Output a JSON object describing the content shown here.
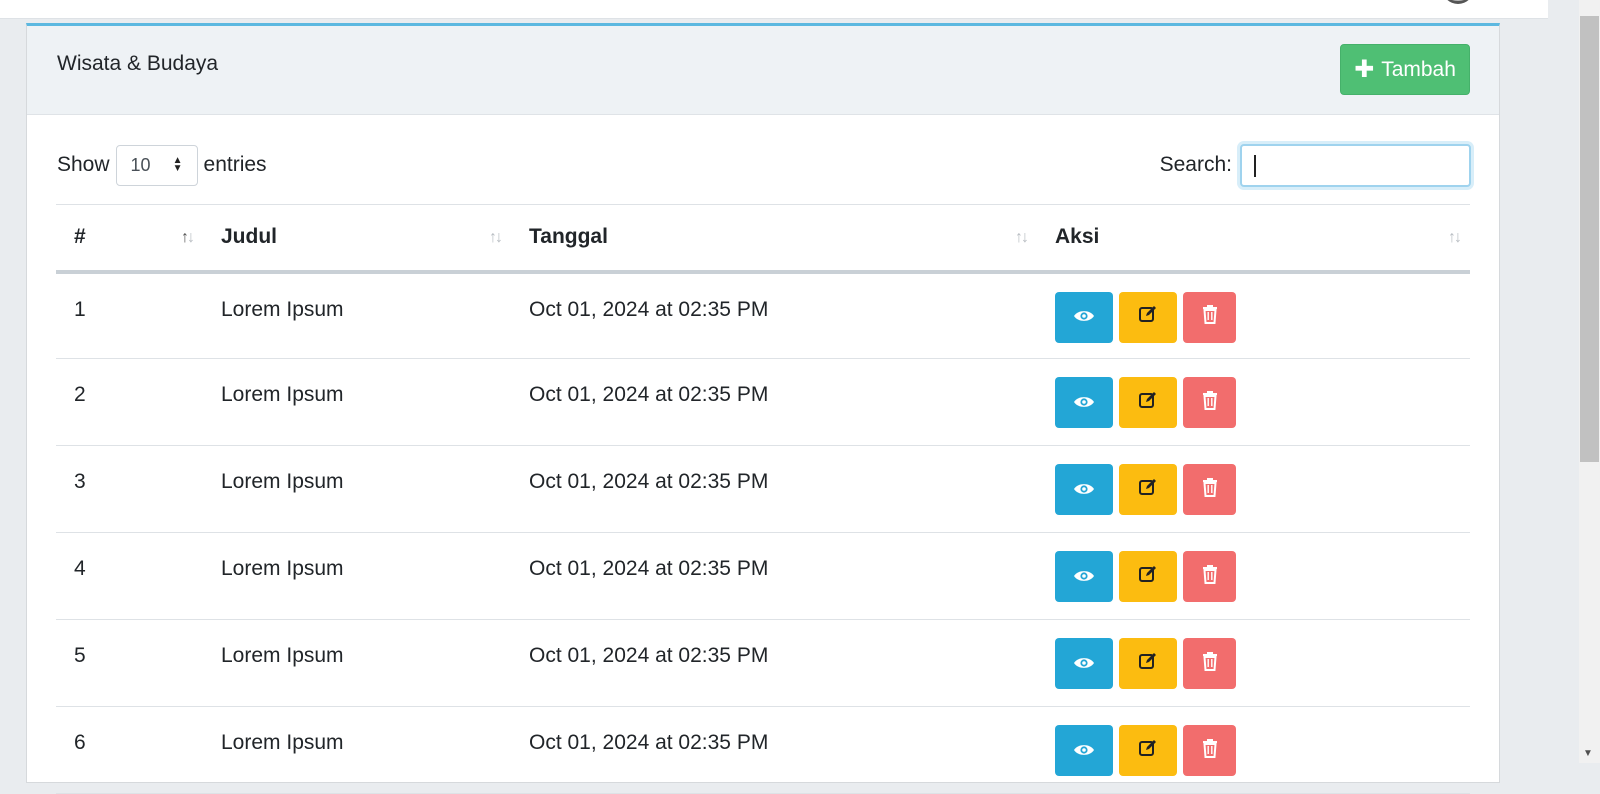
{
  "page": {
    "card_title": "Wisata & Budaya",
    "add_button_label": "Tambah"
  },
  "controls": {
    "show_label": "Show",
    "entries_value": "10",
    "entries_label": "entries",
    "search_label": "Search:",
    "search_value": ""
  },
  "table": {
    "headers": [
      "#",
      "Judul",
      "Tanggal",
      "Aksi"
    ],
    "rows": [
      {
        "num": "1",
        "judul": "Lorem Ipsum",
        "tanggal": "Oct 01, 2024 at 02:35 PM"
      },
      {
        "num": "2",
        "judul": "Lorem Ipsum",
        "tanggal": "Oct 01, 2024 at 02:35 PM"
      },
      {
        "num": "3",
        "judul": "Lorem Ipsum",
        "tanggal": "Oct 01, 2024 at 02:35 PM"
      },
      {
        "num": "4",
        "judul": "Lorem Ipsum",
        "tanggal": "Oct 01, 2024 at 02:35 PM"
      },
      {
        "num": "5",
        "judul": "Lorem Ipsum",
        "tanggal": "Oct 01, 2024 at 02:35 PM"
      },
      {
        "num": "6",
        "judul": "Lorem Ipsum",
        "tanggal": "Oct 01, 2024 at 02:35 PM"
      }
    ],
    "row_action_icons": [
      "eye-icon",
      "edit-icon",
      "trash-icon"
    ]
  },
  "colors": {
    "add_button": "#4fbf74",
    "view_button": "#23a6d6",
    "edit_button": "#fcbc10",
    "delete_button": "#f26d6d",
    "card_accent": "#5cb8e0"
  }
}
